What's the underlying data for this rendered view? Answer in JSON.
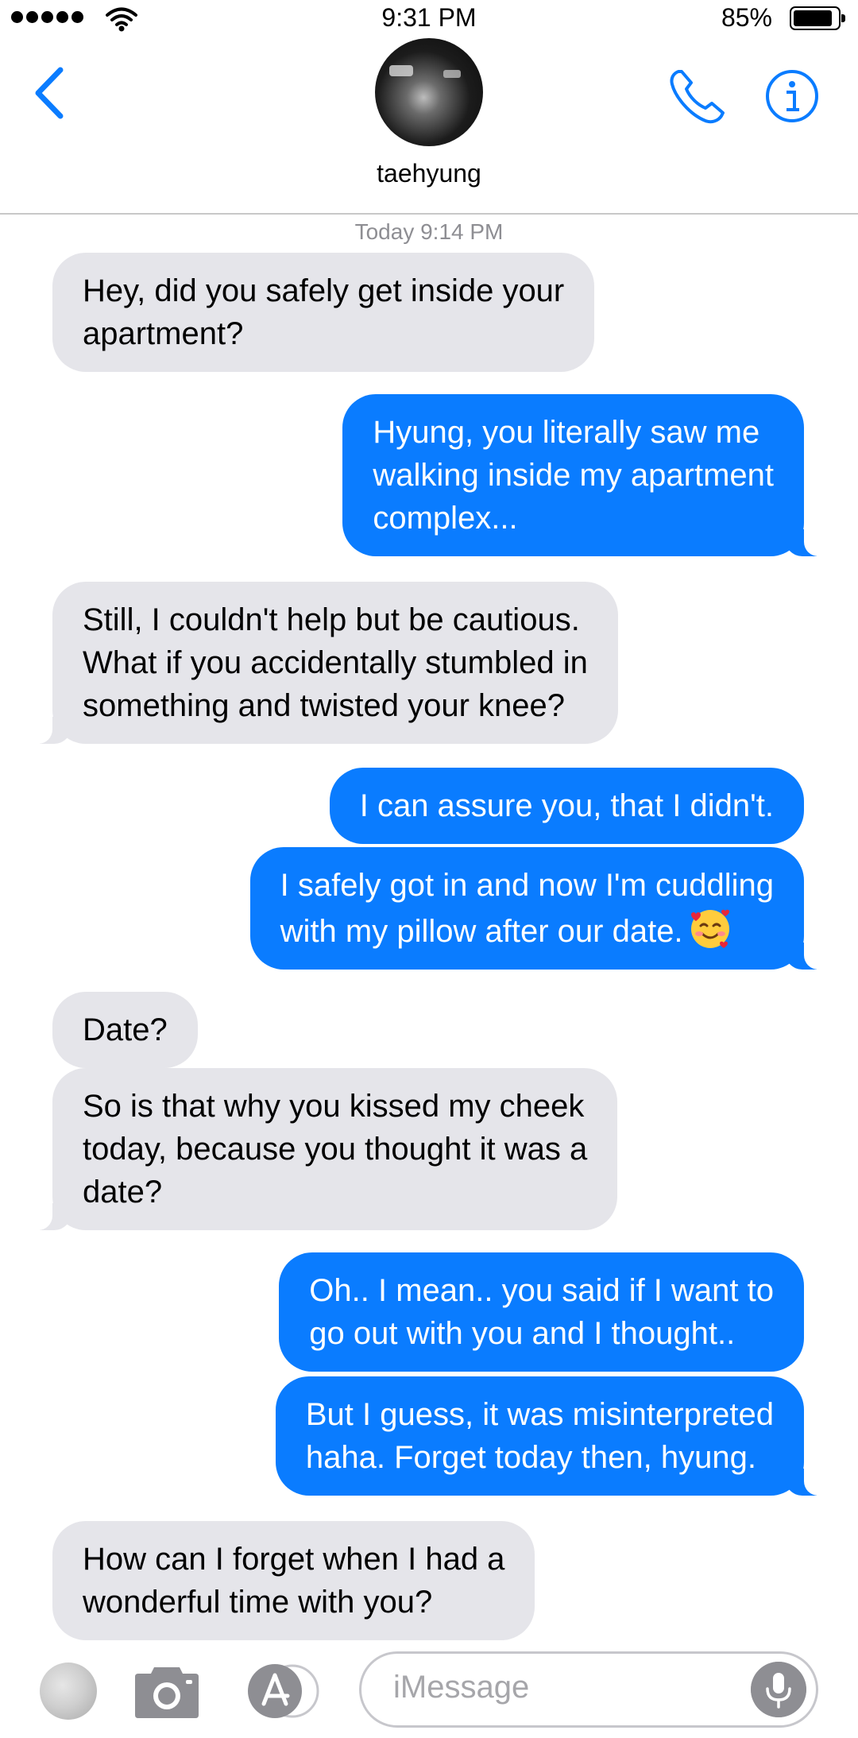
{
  "status_bar": {
    "time": "9:31 PM",
    "battery_percent": "85%",
    "battery_level": 0.85,
    "signal_bars": 5
  },
  "header": {
    "back_icon": "chevron-left-icon",
    "contact_name": "taehyung",
    "call_icon": "phone-icon",
    "info_icon": "info-icon"
  },
  "conversation": {
    "timestamp": "Today 9:14 PM",
    "messages": [
      {
        "from": "them",
        "lines": [
          "Hey, did you safely get inside your",
          "apartment?"
        ]
      },
      {
        "from": "me",
        "lines": [
          "Hyung, you literally saw me",
          "walking inside my apartment",
          "complex..."
        ]
      },
      {
        "from": "them",
        "lines": [
          "Still, I couldn't help but be cautious.",
          "What if you accidentally stumbled in",
          "something and twisted your knee?"
        ]
      },
      {
        "from": "me",
        "lines": [
          "I can assure you, that I didn't."
        ]
      },
      {
        "from": "me",
        "lines": [
          "I safely got in and now I'm cuddling",
          "with my pillow after our date."
        ],
        "emoji": "smiling-face-with-hearts-emoji"
      },
      {
        "from": "them",
        "lines": [
          "Date?"
        ]
      },
      {
        "from": "them",
        "lines": [
          "So is that why you kissed my cheek",
          "today, because you thought it was a",
          "date?"
        ]
      },
      {
        "from": "me",
        "lines": [
          "Oh.. I mean.. you said if I want to",
          "go out with you and I thought.."
        ]
      },
      {
        "from": "me",
        "lines": [
          "But I guess, it was misinterpreted",
          "haha. Forget today then, hyung."
        ]
      },
      {
        "from": "them",
        "lines": [
          "How can I forget when I had a",
          "wonderful time with you?"
        ]
      }
    ]
  },
  "input_bar": {
    "placeholder": "iMessage",
    "icons": [
      "photos-icon",
      "camera-icon",
      "app-store-icon",
      "microphone-icon"
    ]
  },
  "colors": {
    "accent": "#0a7cff",
    "incoming_bubble": "#e5e5ea",
    "timestamp": "#8e8e93"
  }
}
